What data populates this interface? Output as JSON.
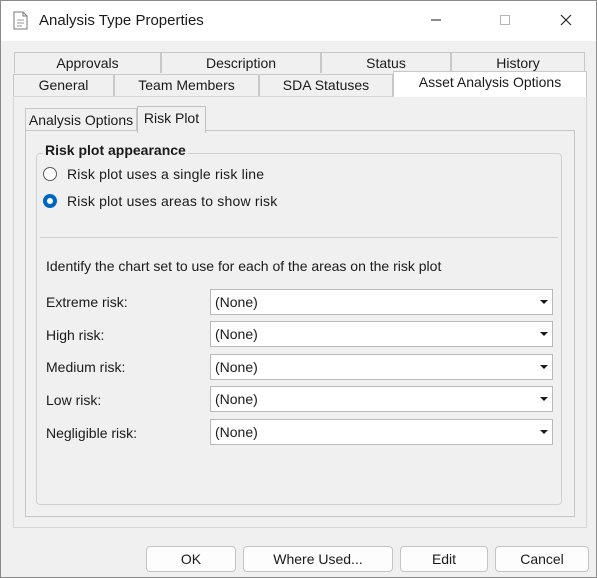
{
  "window": {
    "title": "Analysis Type Properties",
    "icon": "document-icon",
    "controls": [
      "minimize-icon",
      "maximize-icon",
      "close-icon"
    ]
  },
  "tabs_row1": [
    {
      "label": "Approvals"
    },
    {
      "label": "Description"
    },
    {
      "label": "Status"
    },
    {
      "label": "History"
    }
  ],
  "tabs_row2": [
    {
      "label": "General"
    },
    {
      "label": "Team Members"
    },
    {
      "label": "SDA Statuses"
    },
    {
      "label": "Asset Analysis Options",
      "active": true
    }
  ],
  "inner_tabs": [
    {
      "label": "Analysis Options"
    },
    {
      "label": "Risk Plot",
      "active": true
    }
  ],
  "group": {
    "title": "Risk plot appearance",
    "options": [
      {
        "label": "Risk plot uses a single risk line",
        "checked": false
      },
      {
        "label": "Risk plot uses areas to show risk",
        "checked": true
      }
    ]
  },
  "instruction": "Identify the chart set to use for each of the areas on the risk plot",
  "risk_areas": [
    {
      "label": "Extreme risk:",
      "value": "(None)"
    },
    {
      "label": "High risk:",
      "value": "(None)"
    },
    {
      "label": "Medium risk:",
      "value": "(None)"
    },
    {
      "label": "Low risk:",
      "value": "(None)"
    },
    {
      "label": "Negligible risk:",
      "value": "(None)"
    }
  ],
  "buttons": {
    "ok": "OK",
    "where_used": "Where Used...",
    "edit": "Edit",
    "cancel": "Cancel"
  },
  "colors": {
    "accent": "#0067c0",
    "window_bg": "#f0f0f0",
    "titlebar_bg": "#ffffff"
  }
}
